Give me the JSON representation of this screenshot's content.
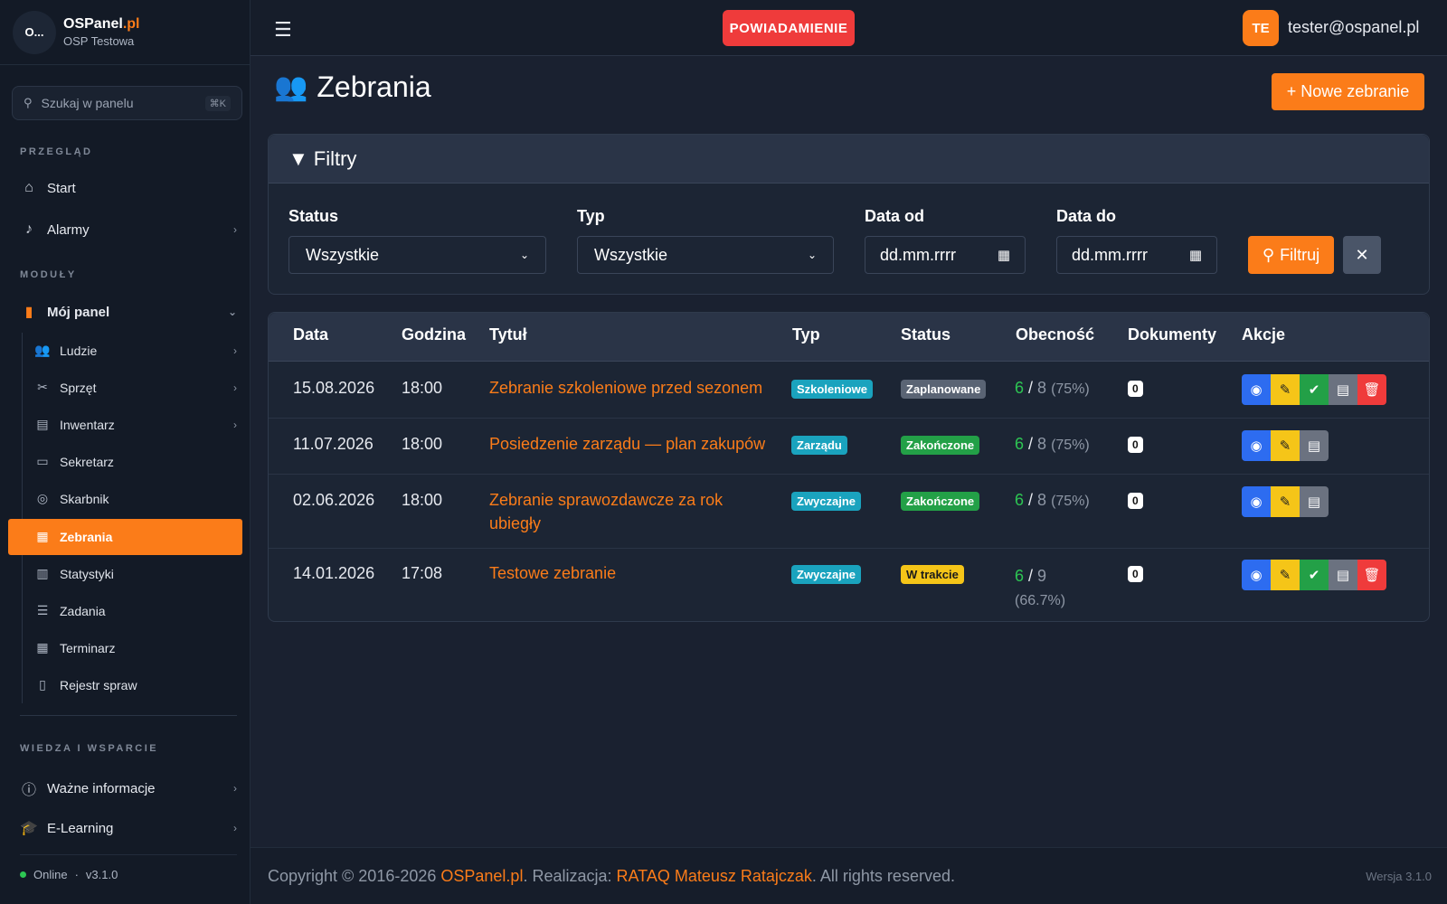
{
  "brand": {
    "name_main": "OSPanel",
    "name_ext": ".pl",
    "subtitle": "OSP Testowa",
    "logo_text": "O..."
  },
  "search": {
    "placeholder": "Szukaj w panelu",
    "shortcut": "⌘K"
  },
  "sidebar": {
    "section_overview": "PRZEGLĄD",
    "section_modules": "MODUŁY",
    "section_help": "WIEDZA I WSPARCIE",
    "overview_items": [
      {
        "label": "Start",
        "icon": "home-icon"
      },
      {
        "label": "Alarmy",
        "icon": "bell-icon"
      }
    ],
    "module_group": {
      "label": "Mój panel",
      "icon": "fire-extinguisher-icon"
    },
    "sub_items": [
      {
        "label": "Ludzie",
        "icon": "users-icon"
      },
      {
        "label": "Sprzęt",
        "icon": "tools-icon"
      },
      {
        "label": "Inwentarz",
        "icon": "book-icon"
      },
      {
        "label": "Sekretarz",
        "icon": "folder-icon"
      },
      {
        "label": "Skarbnik",
        "icon": "coins-icon"
      },
      {
        "label": "Zebrania",
        "icon": "calendar-check-icon"
      },
      {
        "label": "Statystyki",
        "icon": "bar-chart-icon"
      },
      {
        "label": "Zadania",
        "icon": "list-check-icon"
      },
      {
        "label": "Terminarz",
        "icon": "calendar-icon"
      },
      {
        "label": "Rejestr spraw",
        "icon": "clipboard-icon"
      }
    ],
    "help_items": [
      {
        "label": "Ważne informacje",
        "icon": "info-icon"
      },
      {
        "label": "E-Learning",
        "icon": "graduation-cap-icon"
      }
    ],
    "status": "Online",
    "version": "v3.1.0"
  },
  "topbar": {
    "notification": "POWIADAMIENIE",
    "avatar_initials": "TE",
    "user_email": "tester@ospanel.pl"
  },
  "page": {
    "title": "Zebrania",
    "new_button": "+ Nowe zebranie"
  },
  "filters": {
    "title": "Filtry",
    "status_label": "Status",
    "status_value": "Wszystkie",
    "type_label": "Typ",
    "type_value": "Wszystkie",
    "date_from_label": "Data od",
    "date_from_placeholder": "dd.mm.rrrr",
    "date_to_label": "Data do",
    "date_to_placeholder": "dd.mm.rrrr",
    "filter_button": "Filtruj",
    "clear_button": "✕"
  },
  "table": {
    "headers": [
      "Data",
      "Godzina",
      "Tytuł",
      "Typ",
      "Status",
      "Obecność",
      "Dokumenty",
      "Akcje"
    ],
    "rows": [
      {
        "date": "15.08.2026",
        "time": "18:00",
        "title": "Zebranie szkoleniowe przed sezonem",
        "type": "Szkoleniowe",
        "status": "Zaplanowane",
        "present": "6",
        "total": "8",
        "pct": "(75%)",
        "docs": "0"
      },
      {
        "date": "11.07.2026",
        "time": "18:00",
        "title": "Posiedzenie zarządu — plan zakupów",
        "type": "Zarządu",
        "status": "Zakończone",
        "present": "6",
        "total": "8",
        "pct": "(75%)",
        "docs": "0"
      },
      {
        "date": "02.06.2026",
        "time": "18:00",
        "title": "Zebranie sprawozdawcze za rok ubiegły",
        "type": "Zwyczajne",
        "status": "Zakończone",
        "present": "6",
        "total": "8",
        "pct": "(75%)",
        "docs": "0"
      },
      {
        "date": "14.01.2026",
        "time": "17:08",
        "title": "Testowe zebranie",
        "type": "Zwyczajne",
        "status": "W trakcie",
        "present": "6",
        "total": "9",
        "pct": "(66.7%)",
        "docs": "0"
      }
    ]
  },
  "footer": {
    "prefix": "Copyright © 2016-2026 ",
    "brand": "OSPanel.pl",
    "mid": ". Realizacja: ",
    "author": "RATAQ Mateusz Ratajczak",
    "suffix": ". All rights reserved.",
    "version": "Wersja 3.1.0"
  }
}
